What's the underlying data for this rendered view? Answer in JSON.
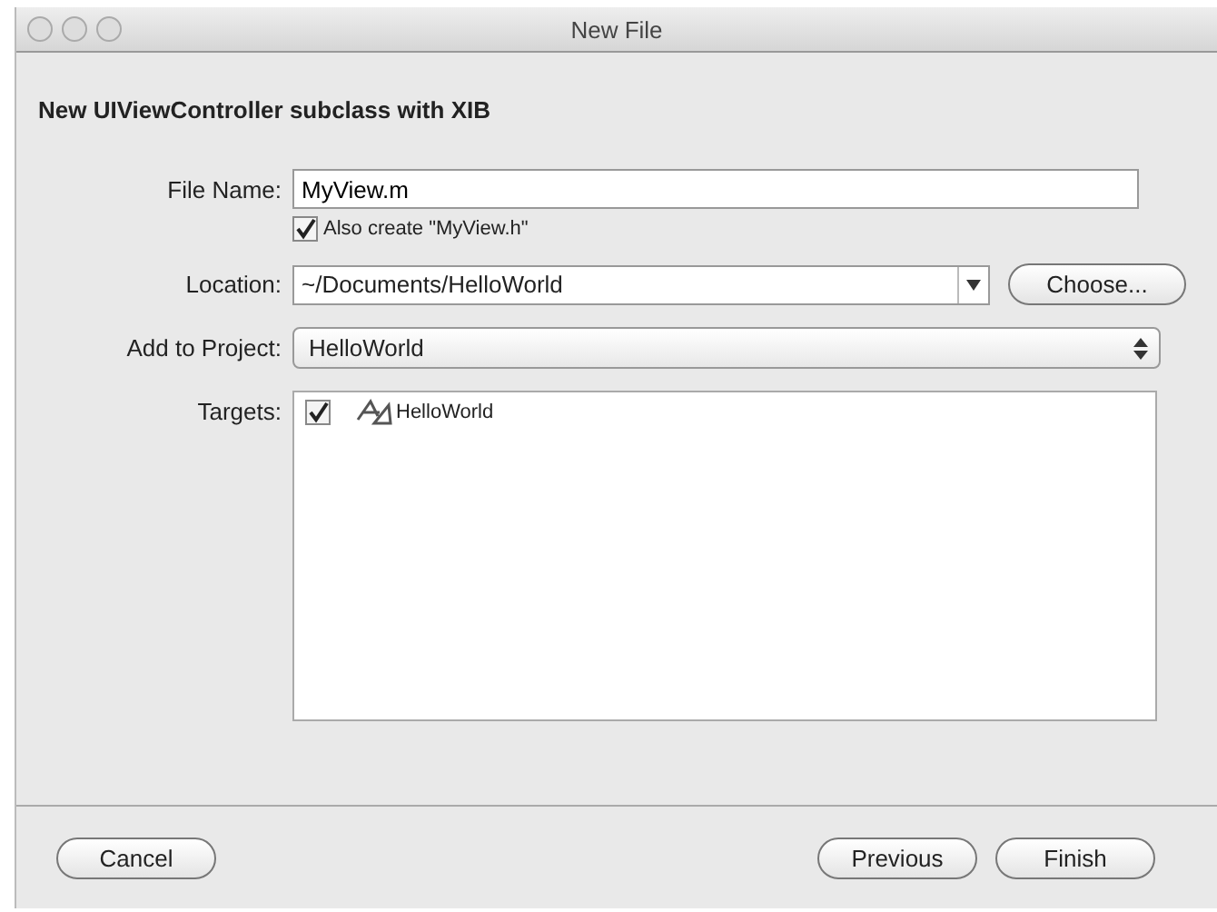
{
  "window": {
    "title": "New File"
  },
  "heading": "New UIViewController subclass with XIB",
  "file_name": {
    "label": "File Name:",
    "value": "MyView.m"
  },
  "also_create": {
    "label": "Also create \"MyView.h\"",
    "checked": true
  },
  "location": {
    "label": "Location:",
    "value": "~/Documents/HelloWorld",
    "button": "Choose..."
  },
  "add_to_project": {
    "label": "Add to Project:",
    "value": "HelloWorld"
  },
  "targets": {
    "label": "Targets:",
    "items": [
      {
        "name": "HelloWorld",
        "checked": true
      }
    ]
  },
  "buttons": {
    "cancel": "Cancel",
    "previous": "Previous",
    "finish": "Finish"
  }
}
